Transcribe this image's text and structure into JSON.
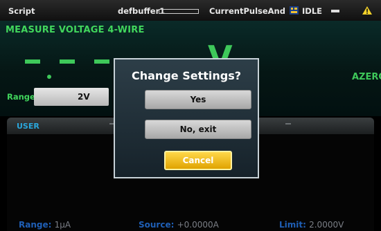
{
  "status_bar": {
    "mode": "Script",
    "buffer_name": "defbuffer1",
    "script_name": "CurrentPulseAnd",
    "state": "IDLE"
  },
  "measure": {
    "function_title": "MEASURE VOLTAGE 4-WIRE",
    "unit": "V",
    "autozero": "AZERO",
    "range_label": "Range",
    "range_value": "2V",
    "colors": {
      "accent_green": "#3ec85a"
    }
  },
  "swipe": {
    "tab_label": "USER"
  },
  "source_info": {
    "range_label": "Range:",
    "range_value": "1µA",
    "source_label": "Source:",
    "source_value": "+0.0000A",
    "limit_label": "Limit:",
    "limit_value": "2.0000V"
  },
  "dialog": {
    "title": "Change Settings?",
    "yes_label": "Yes",
    "no_label": "No, exit",
    "cancel_label": "Cancel"
  },
  "icons": [
    "script-icon",
    "activity-dash-icon",
    "warning-icon"
  ]
}
